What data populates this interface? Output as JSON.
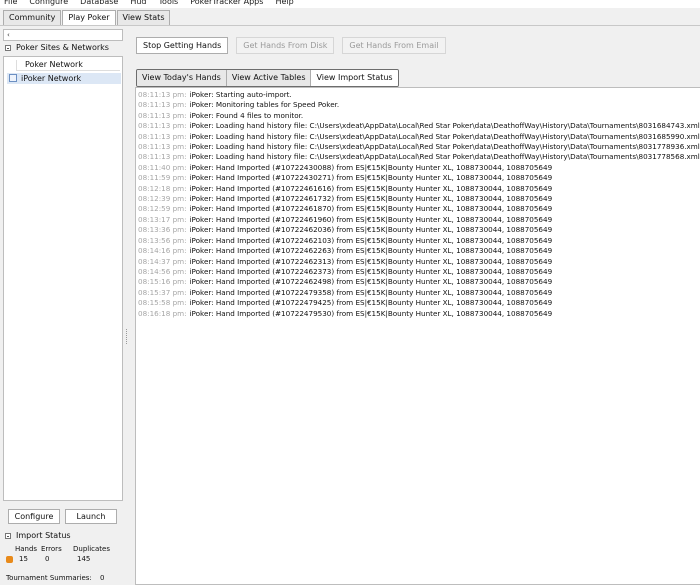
{
  "menu": [
    "File",
    "Configure",
    "Database",
    "Hud",
    "Tools",
    "PokerTracker Apps",
    "Help"
  ],
  "main_tabs": [
    {
      "label": "Community",
      "active": false
    },
    {
      "label": "Play Poker",
      "active": true
    },
    {
      "label": "View Stats",
      "active": false
    }
  ],
  "left": {
    "collapse_glyph": "‹",
    "sites_header": "Poker Sites & Networks",
    "network_column": "Poker Network",
    "network_selected": "iPoker Network",
    "configure_label": "Configure",
    "launch_label": "Launch",
    "import_status_header": "Import Status",
    "stats_headers": [
      "Hands",
      "Errors",
      "Duplicates"
    ],
    "stats_values": [
      "15",
      "0",
      "145"
    ],
    "tournament_summaries_label": "Tournament Summaries:",
    "tournament_summaries_value": "0"
  },
  "toolbar": {
    "stop_label": "Stop Getting Hands",
    "disk_label": "Get Hands From Disk",
    "email_label": "Get Hands From Email"
  },
  "sub_tabs": [
    {
      "label": "View Today's Hands",
      "active": false
    },
    {
      "label": "View Active Tables",
      "active": false
    },
    {
      "label": "View Import Status",
      "active": true
    }
  ],
  "log_lines": [
    {
      "ts": "08:11:13 pm:",
      "msg": "iPoker: Starting auto-import."
    },
    {
      "ts": "08:11:13 pm:",
      "msg": "iPoker: Monitoring tables for Speed Poker."
    },
    {
      "ts": "08:11:13 pm:",
      "msg": "iPoker: Found 4 files to monitor."
    },
    {
      "ts": "08:11:13 pm:",
      "msg": "iPoker: Loading hand history file: C:\\Users\\xdeat\\AppData\\Local\\Red Star Poker\\data\\DeathoffWay\\History\\Data\\Tournaments\\8031684743.xml"
    },
    {
      "ts": "08:11:13 pm:",
      "msg": "iPoker: Loading hand history file: C:\\Users\\xdeat\\AppData\\Local\\Red Star Poker\\data\\DeathoffWay\\History\\Data\\Tournaments\\8031685990.xml"
    },
    {
      "ts": "08:11:13 pm:",
      "msg": "iPoker: Loading hand history file: C:\\Users\\xdeat\\AppData\\Local\\Red Star Poker\\data\\DeathoffWay\\History\\Data\\Tournaments\\8031778936.xml"
    },
    {
      "ts": "08:11:13 pm:",
      "msg": "iPoker: Loading hand history file: C:\\Users\\xdeat\\AppData\\Local\\Red Star Poker\\data\\DeathoffWay\\History\\Data\\Tournaments\\8031778568.xml"
    },
    {
      "ts": "08:11:40 pm:",
      "msg": "iPoker: Hand Imported (#10722430088) from ES|€15K|Bounty Hunter XL, 1088730044, 1088705649"
    },
    {
      "ts": "08:11:59 pm:",
      "msg": "iPoker: Hand Imported (#10722430271) from ES|€15K|Bounty Hunter XL, 1088730044, 1088705649"
    },
    {
      "ts": "08:12:18 pm:",
      "msg": "iPoker: Hand Imported (#10722461616) from ES|€15K|Bounty Hunter XL, 1088730044, 1088705649"
    },
    {
      "ts": "08:12:39 pm:",
      "msg": "iPoker: Hand Imported (#10722461732) from ES|€15K|Bounty Hunter XL, 1088730044, 1088705649"
    },
    {
      "ts": "08:12:59 pm:",
      "msg": "iPoker: Hand Imported (#10722461870) from ES|€15K|Bounty Hunter XL, 1088730044, 1088705649"
    },
    {
      "ts": "08:13:17 pm:",
      "msg": "iPoker: Hand Imported (#10722461960) from ES|€15K|Bounty Hunter XL, 1088730044, 1088705649"
    },
    {
      "ts": "08:13:36 pm:",
      "msg": "iPoker: Hand Imported (#10722462036) from ES|€15K|Bounty Hunter XL, 1088730044, 1088705649"
    },
    {
      "ts": "08:13:56 pm:",
      "msg": "iPoker: Hand Imported (#10722462103) from ES|€15K|Bounty Hunter XL, 1088730044, 1088705649"
    },
    {
      "ts": "08:14:16 pm:",
      "msg": "iPoker: Hand Imported (#10722462263) from ES|€15K|Bounty Hunter XL, 1088730044, 1088705649"
    },
    {
      "ts": "08:14:37 pm:",
      "msg": "iPoker: Hand Imported (#10722462313) from ES|€15K|Bounty Hunter XL, 1088730044, 1088705649"
    },
    {
      "ts": "08:14:56 pm:",
      "msg": "iPoker: Hand Imported (#10722462373) from ES|€15K|Bounty Hunter XL, 1088730044, 1088705649"
    },
    {
      "ts": "08:15:16 pm:",
      "msg": "iPoker: Hand Imported (#10722462498) from ES|€15K|Bounty Hunter XL, 1088730044, 1088705649"
    },
    {
      "ts": "08:15:37 pm:",
      "msg": "iPoker: Hand Imported (#10722479358) from ES|€15K|Bounty Hunter XL, 1088730044, 1088705649"
    },
    {
      "ts": "08:15:58 pm:",
      "msg": "iPoker: Hand Imported (#10722479425) from ES|€15K|Bounty Hunter XL, 1088730044, 1088705649"
    },
    {
      "ts": "08:16:18 pm:",
      "msg": "iPoker: Hand Imported (#10722479530) from ES|€15K|Bounty Hunter XL, 1088730044, 1088705649"
    }
  ]
}
